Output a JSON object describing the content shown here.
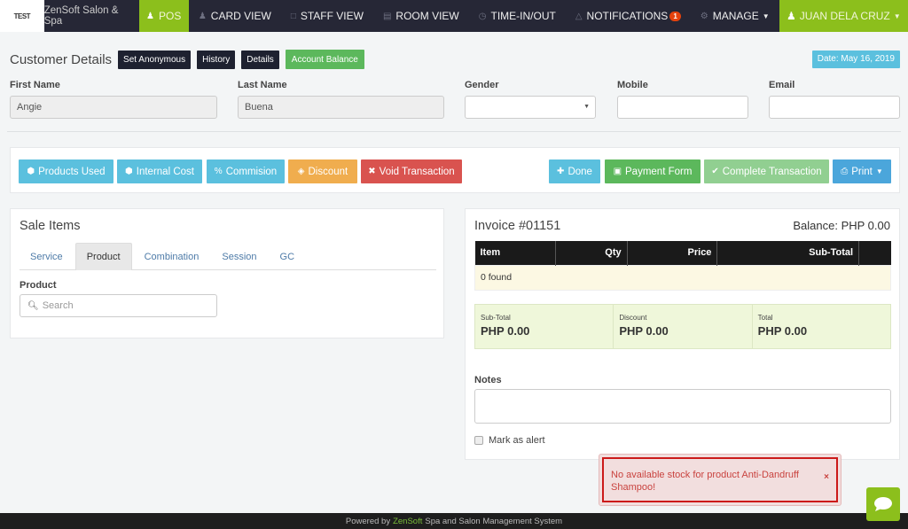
{
  "navbar": {
    "logo": "TEST",
    "brand": "ZenSoft Salon & Spa",
    "items": [
      {
        "label": "POS",
        "icon": "user-plus-icon",
        "active": true
      },
      {
        "label": "CARD VIEW",
        "icon": "users-icon"
      },
      {
        "label": "STAFF VIEW",
        "icon": "calendar-icon"
      },
      {
        "label": "ROOM VIEW",
        "icon": "bed-icon"
      },
      {
        "label": "TIME-IN/OUT",
        "icon": "clock-icon"
      },
      {
        "label": "NOTIFICATIONS",
        "icon": "bell-icon",
        "badge": "1"
      },
      {
        "label": "MANAGE",
        "icon": "gear-icon",
        "dropdown": true
      }
    ],
    "user": "JUAN DELA CRUZ"
  },
  "customer": {
    "title": "Customer Details",
    "buttons": [
      "Set Anonymous",
      "History",
      "Details",
      "Account Balance"
    ],
    "date": "Date: May 16, 2019",
    "fields": {
      "first_name": {
        "label": "First Name",
        "value": "Angie"
      },
      "last_name": {
        "label": "Last Name",
        "value": "Buena"
      },
      "gender": {
        "label": "Gender",
        "value": ""
      },
      "mobile": {
        "label": "Mobile",
        "value": ""
      },
      "email": {
        "label": "Email",
        "value": ""
      }
    }
  },
  "actions": {
    "left": [
      "Products Used",
      "Internal Cost",
      "Commision",
      "Discount",
      "Void Transaction"
    ],
    "right": [
      "Done",
      "Payment Form",
      "Complete Transaction",
      "Print"
    ]
  },
  "sale_items": {
    "title": "Sale Items",
    "tabs": [
      "Service",
      "Product",
      "Combination",
      "Session",
      "GC"
    ],
    "active_tab": "Product",
    "product_label": "Product",
    "search_placeholder": "Search"
  },
  "invoice": {
    "title": "Invoice #01151",
    "balance": "Balance: PHP 0.00",
    "columns": [
      "Item",
      "Qty",
      "Price",
      "Sub-Total",
      ""
    ],
    "empty": "0 found",
    "totals": [
      {
        "label": "Sub-Total",
        "value": "PHP 0.00"
      },
      {
        "label": "Discount",
        "value": "PHP 0.00"
      },
      {
        "label": "Total",
        "value": "PHP 0.00"
      }
    ],
    "notes_label": "Notes",
    "notes_value": "",
    "mark_alert": "Mark as alert"
  },
  "toast": {
    "message": "No available stock for product Anti-Dandruff Shampoo!",
    "close": "×"
  },
  "footer": {
    "prefix": "Powered by",
    "brand": "ZenSoft",
    "suffix": "Spa and Salon Management System"
  },
  "colors": {
    "nav_bg": "#262736",
    "accent_green": "#8cbf1c",
    "info": "#5bc0de",
    "danger": "#d9534f",
    "warning": "#f0ad4e",
    "success": "#5cb85c"
  }
}
